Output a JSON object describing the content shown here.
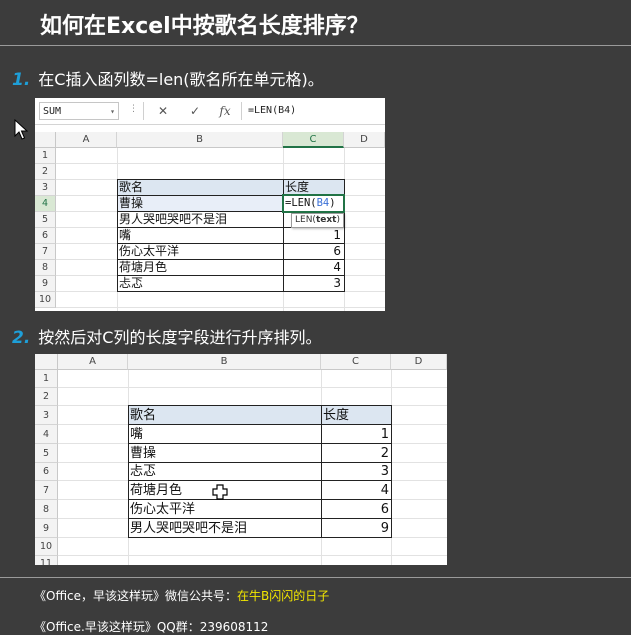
{
  "title": "如何在Excel中按歌名长度排序？",
  "steps": [
    {
      "num": "1.",
      "text": "在C插入函列数=len(歌名所在单元格)。"
    },
    {
      "num": "2.",
      "text": "按然后对C列的长度字段进行升序排列。"
    }
  ],
  "shot1": {
    "name_box": "SUM",
    "cancel_glyph": "✕",
    "enter_glyph": "✓",
    "fx_glyph": "fx",
    "formula": "=LEN(B4)",
    "columns": [
      "A",
      "B",
      "C",
      "D"
    ],
    "rows": [
      "1",
      "2",
      "3",
      "4",
      "5",
      "6",
      "7",
      "8",
      "9",
      "10"
    ],
    "header": {
      "song": "歌名",
      "length": "长度"
    },
    "songs": [
      "曹操",
      "男人哭吧哭吧不是泪",
      "嘴",
      "伤心太平洋",
      "荷塘月色",
      "忐忑"
    ],
    "lengths": [
      "",
      "",
      "1",
      "6",
      "4",
      "3"
    ],
    "editing_cell": "=LEN(B4)",
    "edit_prefix": "=LEN(",
    "edit_ref": "B4",
    "edit_suffix": ")",
    "tooltip_fn": "LEN(",
    "tooltip_arg": "text",
    "tooltip_end": ")"
  },
  "shot2": {
    "columns": [
      "A",
      "B",
      "C",
      "D"
    ],
    "rows": [
      "1",
      "2",
      "3",
      "4",
      "5",
      "6",
      "7",
      "8",
      "9",
      "10",
      "11"
    ],
    "header": {
      "song": "歌名",
      "length": "长度"
    },
    "songs": [
      "嘴",
      "曹操",
      "忐忑",
      "荷塘月色",
      "伤心太平洋",
      "男人哭吧哭吧不是泪"
    ],
    "lengths": [
      "1",
      "2",
      "3",
      "4",
      "6",
      "9"
    ]
  },
  "footer": {
    "line1_prefix": "《Office，早该这样玩》微信公共号：",
    "line1_highlight": "在牛B闪闪的日子",
    "line2": "《Office.早该这样玩》QQ群：239608112"
  },
  "colors": {
    "accent_number": "#1e9fd8",
    "highlight": "#f2e600",
    "excel_green": "#217346",
    "header_fill": "#dce6f1"
  }
}
